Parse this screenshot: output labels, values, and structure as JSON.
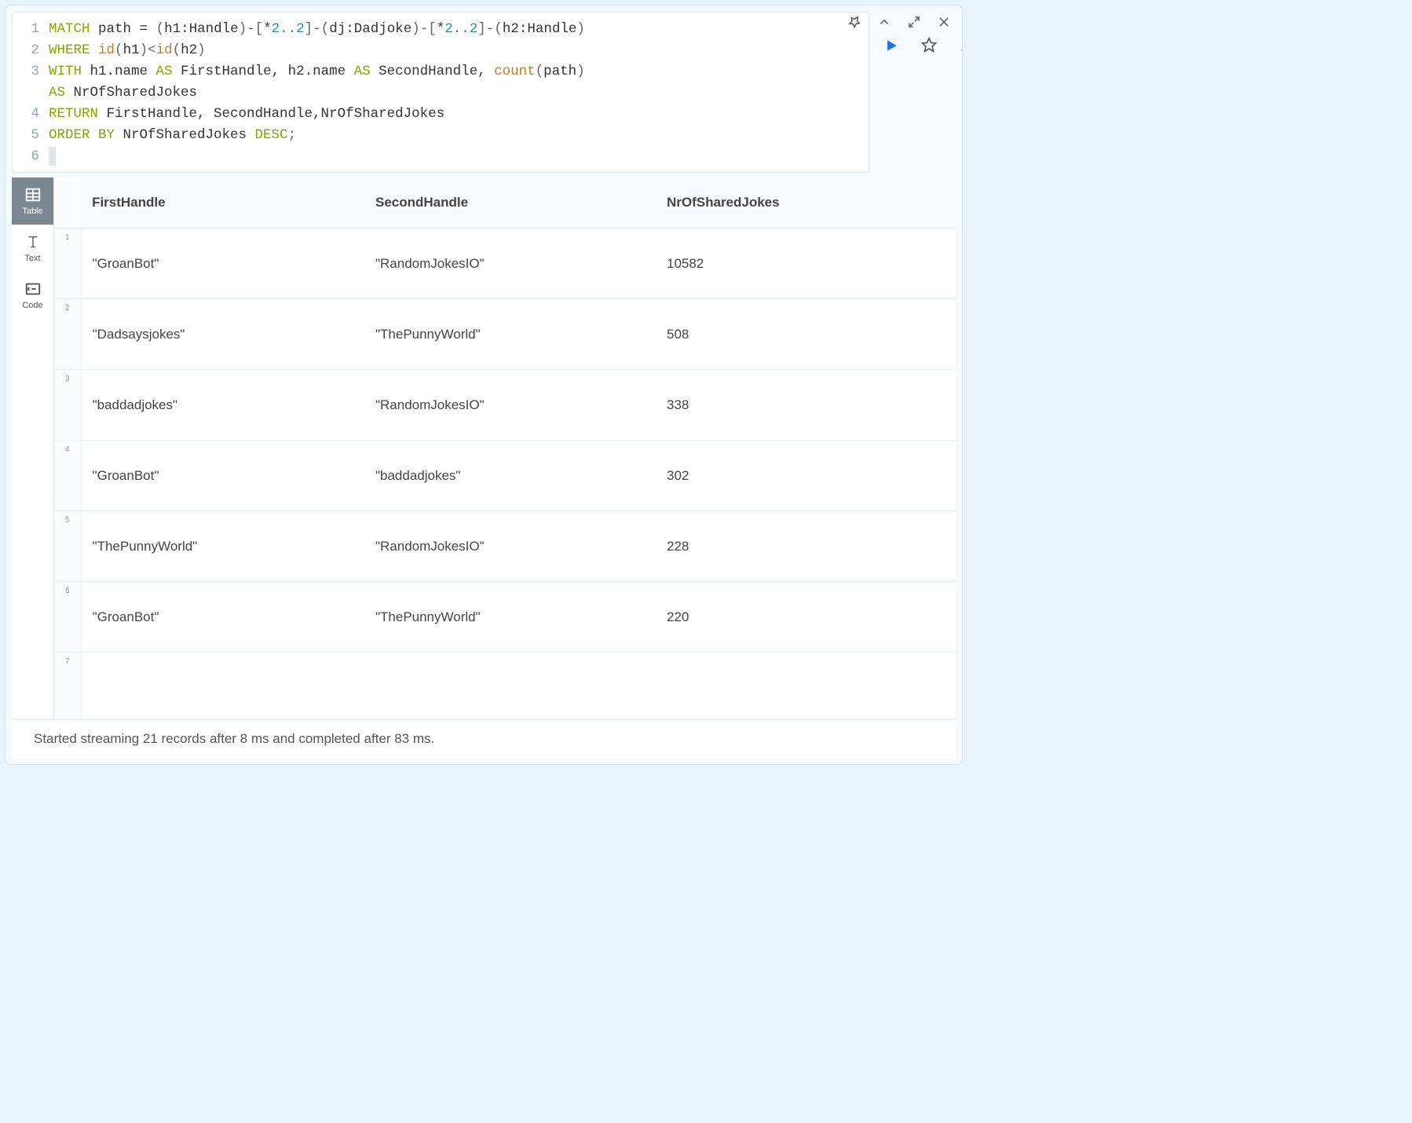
{
  "topIcons": [
    "pin-icon",
    "chevron-up-icon",
    "expand-icon",
    "close-icon"
  ],
  "editor": {
    "lineNumbers": [
      "1",
      "2",
      "3",
      "",
      "4",
      "5",
      "6"
    ],
    "lines": [
      [
        {
          "t": "MATCH",
          "c": "kw"
        },
        {
          "t": " path ",
          "c": "ident"
        },
        {
          "t": "=",
          "c": "op"
        },
        {
          "t": " ",
          "c": ""
        },
        {
          "t": "(",
          "c": "punc"
        },
        {
          "t": "h1:Handle",
          "c": "ident"
        },
        {
          "t": ")-[",
          "c": "punc"
        },
        {
          "t": "*",
          "c": "op"
        },
        {
          "t": "2",
          "c": "num"
        },
        {
          "t": "..",
          "c": "punc"
        },
        {
          "t": "2",
          "c": "num"
        },
        {
          "t": "]-(",
          "c": "punc"
        },
        {
          "t": "dj:Dadjoke",
          "c": "ident"
        },
        {
          "t": ")-[",
          "c": "punc"
        },
        {
          "t": "*",
          "c": "op"
        },
        {
          "t": "2",
          "c": "num"
        },
        {
          "t": "..",
          "c": "punc"
        },
        {
          "t": "2",
          "c": "num"
        },
        {
          "t": "]-(",
          "c": "punc"
        },
        {
          "t": "h2:Handle",
          "c": "ident"
        },
        {
          "t": ")",
          "c": "punc"
        }
      ],
      [
        {
          "t": "WHERE",
          "c": "kw"
        },
        {
          "t": " ",
          "c": ""
        },
        {
          "t": "id",
          "c": "fn"
        },
        {
          "t": "(",
          "c": "punc"
        },
        {
          "t": "h1",
          "c": "ident"
        },
        {
          "t": ")<",
          "c": "punc"
        },
        {
          "t": "id",
          "c": "fn"
        },
        {
          "t": "(",
          "c": "punc"
        },
        {
          "t": "h2",
          "c": "ident"
        },
        {
          "t": ")",
          "c": "punc"
        }
      ],
      [
        {
          "t": "WITH",
          "c": "kw"
        },
        {
          "t": " h1.name ",
          "c": "ident"
        },
        {
          "t": "AS",
          "c": "kw"
        },
        {
          "t": " FirstHandle, h2.name ",
          "c": "ident"
        },
        {
          "t": "AS",
          "c": "kw"
        },
        {
          "t": " SecondHandle, ",
          "c": "ident"
        },
        {
          "t": "count",
          "c": "fn"
        },
        {
          "t": "(",
          "c": "punc"
        },
        {
          "t": "path",
          "c": "ident"
        },
        {
          "t": ")",
          "c": "punc"
        }
      ],
      [
        {
          "t": "AS",
          "c": "kw"
        },
        {
          "t": " NrOfSharedJokes",
          "c": "ident"
        }
      ],
      [
        {
          "t": "RETURN",
          "c": "kw"
        },
        {
          "t": " FirstHandle, SecondHandle,NrOfSharedJokes",
          "c": "ident"
        }
      ],
      [
        {
          "t": "ORDER BY",
          "c": "kw"
        },
        {
          "t": " NrOfSharedJokes ",
          "c": "ident"
        },
        {
          "t": "DESC",
          "c": "kw"
        },
        {
          "t": ";",
          "c": "punc"
        }
      ],
      []
    ]
  },
  "sideTabs": [
    {
      "name": "table",
      "label": "Table",
      "active": true
    },
    {
      "name": "text",
      "label": "Text",
      "active": false
    },
    {
      "name": "code",
      "label": "Code",
      "active": false
    }
  ],
  "table": {
    "columns": [
      "FirstHandle",
      "SecondHandle",
      "NrOfSharedJokes"
    ],
    "rows": [
      {
        "n": "1",
        "cells": [
          "\"GroanBot\"",
          "\"RandomJokesIO\"",
          "10582"
        ]
      },
      {
        "n": "2",
        "cells": [
          "\"Dadsaysjokes\"",
          "\"ThePunnyWorld\"",
          "508"
        ]
      },
      {
        "n": "3",
        "cells": [
          "\"baddadjokes\"",
          "\"RandomJokesIO\"",
          "338"
        ]
      },
      {
        "n": "4",
        "cells": [
          "\"GroanBot\"",
          "\"baddadjokes\"",
          "302"
        ]
      },
      {
        "n": "5",
        "cells": [
          "\"ThePunnyWorld\"",
          "\"RandomJokesIO\"",
          "228"
        ]
      },
      {
        "n": "6",
        "cells": [
          "\"GroanBot\"",
          "\"ThePunnyWorld\"",
          "220"
        ]
      },
      {
        "n": "7",
        "cells": [
          "",
          "",
          ""
        ]
      }
    ]
  },
  "status": "Started streaming 21 records after 8 ms and completed after 83 ms."
}
